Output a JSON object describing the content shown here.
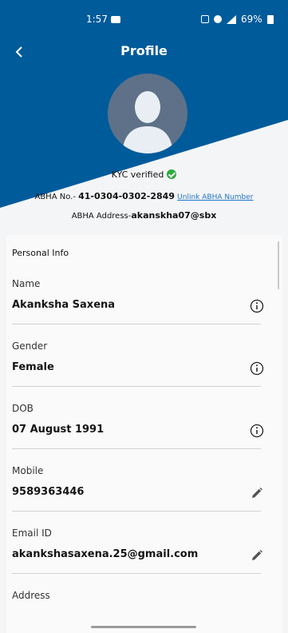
{
  "status_bar": {
    "time": "1:57",
    "battery": "69%"
  },
  "header": {
    "title": "Profile",
    "back_icon": "chevron-left-icon",
    "bg_color": "#005b9b"
  },
  "kyc": {
    "text": "KYC verified",
    "icon": "check-circle-icon",
    "color": "#2cab3d"
  },
  "abha": {
    "number_label": "ABHA No.-",
    "number": "41-0304-0302-2849",
    "unlink_label": "Unlink ABHA Number",
    "address_label": "ABHA Address-",
    "address": "akanskha07@sbx"
  },
  "section_title": "Personal Info",
  "fields": [
    {
      "label": "Name",
      "value": "Akanksha  Saxena",
      "icon": "info-icon"
    },
    {
      "label": "Gender",
      "value": "Female",
      "icon": "info-icon"
    },
    {
      "label": "DOB",
      "value": "07 August 1991",
      "icon": "info-icon"
    },
    {
      "label": "Mobile",
      "value": "9589363446",
      "icon": "edit-icon"
    },
    {
      "label": "Email ID",
      "value": "akankshasaxena.25@gmail.com",
      "icon": "edit-icon"
    },
    {
      "label": "Address",
      "value": "",
      "icon": ""
    }
  ]
}
